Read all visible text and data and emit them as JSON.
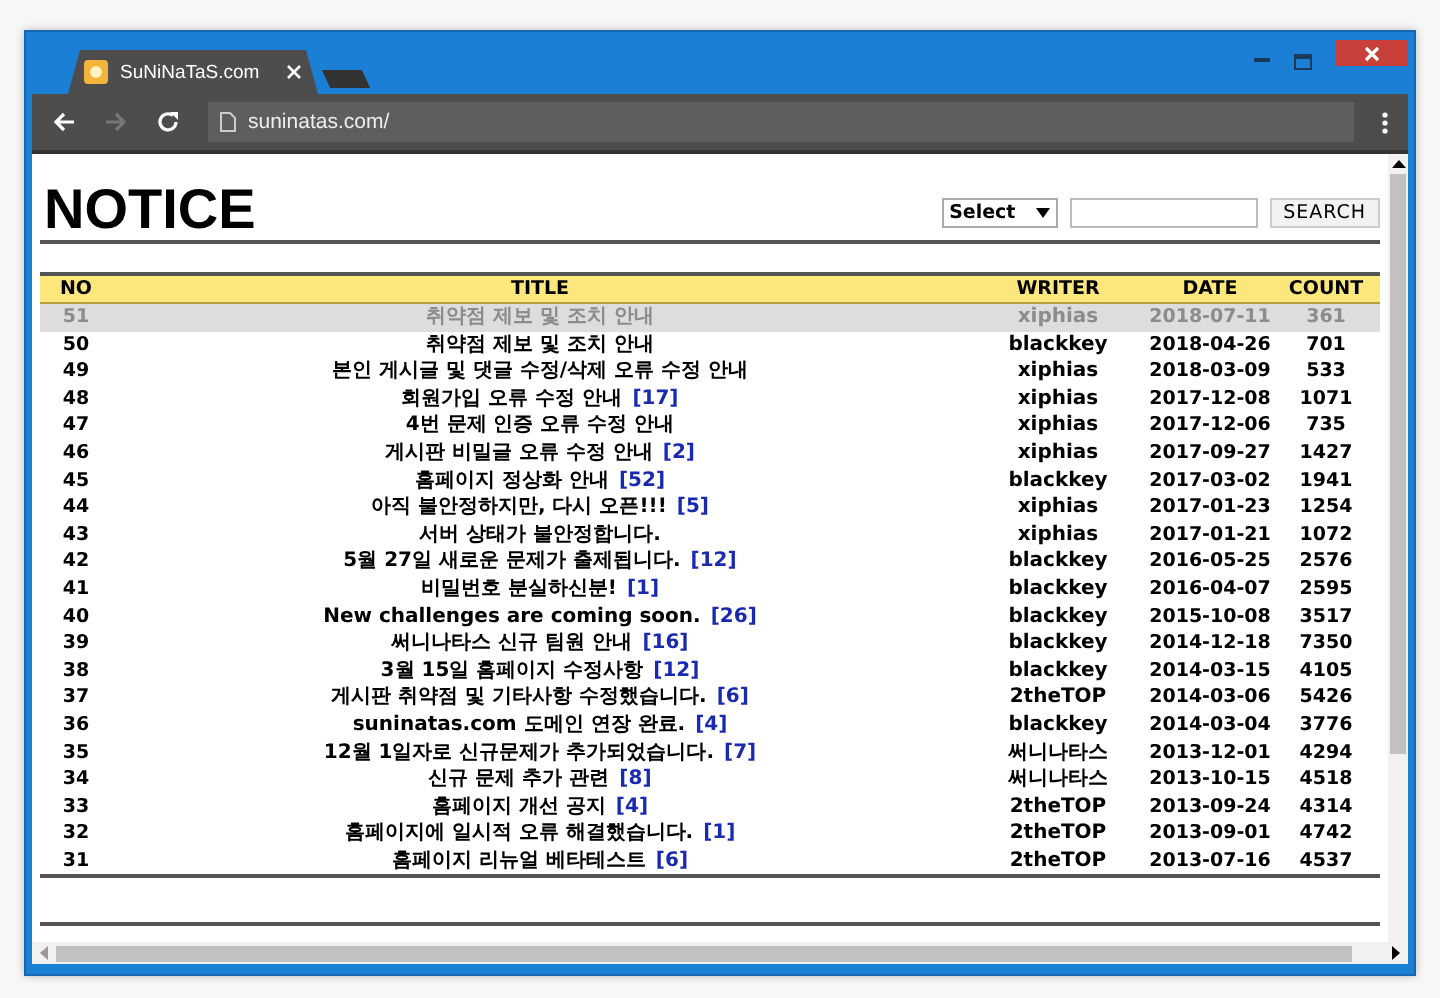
{
  "browser": {
    "tab": {
      "title": "SuNiNaTaS.com"
    },
    "address": "suninatas.com/"
  },
  "page": {
    "title": "NOTICE",
    "search": {
      "select": "Select",
      "button": "SEARCH"
    }
  },
  "table": {
    "columns": [
      "NO",
      "TITLE",
      "WRITER",
      "DATE",
      "COUNT"
    ],
    "rows": [
      {
        "no": "51",
        "title": "취약점 제보 및 조치 안내",
        "writer": "xiphias",
        "date": "2018-07-11",
        "count": "361",
        "selected": true
      },
      {
        "no": "50",
        "title": "취약점 제보 및 조치 안내",
        "writer": "blackkey",
        "date": "2018-04-26",
        "count": "701",
        "selected": false
      },
      {
        "no": "49",
        "title": "본인 게시글 및 댓글 수정/삭제 오류 수정 안내",
        "writer": "xiphias",
        "date": "2018-03-09",
        "count": "533",
        "selected": false
      },
      {
        "no": "48",
        "title": "회원가입 오류 수정 안내",
        "comments": "[17]",
        "writer": "xiphias",
        "date": "2017-12-08",
        "count": "1071",
        "selected": false
      },
      {
        "no": "47",
        "title": "4번 문제 인증 오류 수정 안내",
        "writer": "xiphias",
        "date": "2017-12-06",
        "count": "735",
        "selected": false
      },
      {
        "no": "46",
        "title": "게시판 비밀글 오류 수정 안내",
        "comments": "[2]",
        "writer": "xiphias",
        "date": "2017-09-27",
        "count": "1427",
        "selected": false
      },
      {
        "no": "45",
        "title": "홈페이지 정상화 안내",
        "comments": "[52]",
        "writer": "blackkey",
        "date": "2017-03-02",
        "count": "1941",
        "selected": false
      },
      {
        "no": "44",
        "title": "아직 불안정하지만, 다시 오픈!!!",
        "comments": "[5]",
        "writer": "xiphias",
        "date": "2017-01-23",
        "count": "1254",
        "selected": false
      },
      {
        "no": "43",
        "title": "서버 상태가 불안정합니다.",
        "writer": "xiphias",
        "date": "2017-01-21",
        "count": "1072",
        "selected": false
      },
      {
        "no": "42",
        "title": "5월 27일 새로운 문제가 출제됩니다.",
        "comments": "[12]",
        "writer": "blackkey",
        "date": "2016-05-25",
        "count": "2576",
        "selected": false
      },
      {
        "no": "41",
        "title": "비밀번호 분실하신분!",
        "comments": "[1]",
        "writer": "blackkey",
        "date": "2016-04-07",
        "count": "2595",
        "selected": false
      },
      {
        "no": "40",
        "title": "New challenges are coming soon.",
        "comments": "[26]",
        "writer": "blackkey",
        "date": "2015-10-08",
        "count": "3517",
        "selected": false
      },
      {
        "no": "39",
        "title": "써니나타스 신규 팀원 안내",
        "comments": "[16]",
        "writer": "blackkey",
        "date": "2014-12-18",
        "count": "7350",
        "selected": false
      },
      {
        "no": "38",
        "title": "3월 15일 홈페이지 수정사항",
        "comments": "[12]",
        "writer": "blackkey",
        "date": "2014-03-15",
        "count": "4105",
        "selected": false
      },
      {
        "no": "37",
        "title": "게시판 취약점 및 기타사항 수정했습니다.",
        "comments": "[6]",
        "writer": "2theTOP",
        "date": "2014-03-06",
        "count": "5426",
        "selected": false
      },
      {
        "no": "36",
        "title": "suninatas.com 도메인 연장 완료.",
        "comments": "[4]",
        "writer": "blackkey",
        "date": "2014-03-04",
        "count": "3776",
        "selected": false
      },
      {
        "no": "35",
        "title": "12월 1일자로 신규문제가 추가되었습니다.",
        "comments": "[7]",
        "writer": "써니나타스",
        "date": "2013-12-01",
        "count": "4294",
        "selected": false
      },
      {
        "no": "34",
        "title": "신규 문제 추가 관련",
        "comments": "[8]",
        "writer": "써니나타스",
        "date": "2013-10-15",
        "count": "4518",
        "selected": false
      },
      {
        "no": "33",
        "title": "홈페이지 개선 공지",
        "comments": "[4]",
        "writer": "2theTOP",
        "date": "2013-09-24",
        "count": "4314",
        "selected": false
      },
      {
        "no": "32",
        "title": "홈페이지에 일시적 오류 해결했습니다.",
        "comments": "[1]",
        "writer": "2theTOP",
        "date": "2013-09-01",
        "count": "4742",
        "selected": false
      },
      {
        "no": "31",
        "title": "홈페이지 리뉴얼 베타테스트",
        "comments": "[6]",
        "writer": "2theTOP",
        "date": "2013-07-16",
        "count": "4537",
        "selected": false
      }
    ]
  }
}
